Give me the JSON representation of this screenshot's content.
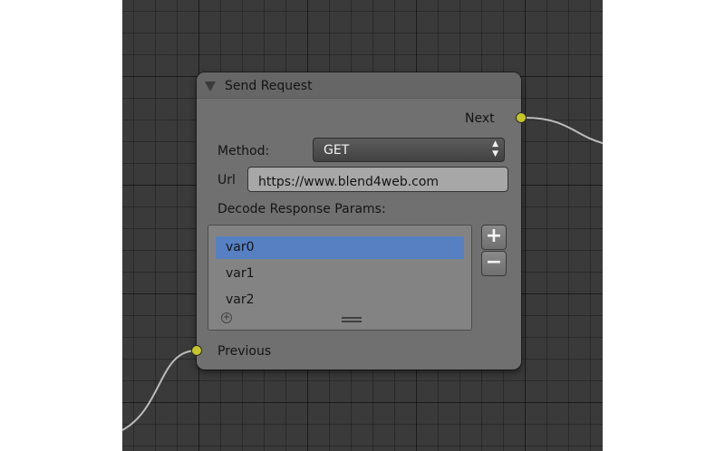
{
  "node": {
    "title": "Send Request",
    "outputs": {
      "next_label": "Next"
    },
    "inputs": {
      "previous_label": "Previous"
    },
    "method": {
      "label": "Method:",
      "value": "GET"
    },
    "url": {
      "label": "Url",
      "value": "https://www.blend4web.com"
    },
    "decode": {
      "label": "Decode Response Params:",
      "items": [
        {
          "label": "var0",
          "selected": true
        },
        {
          "label": "var1",
          "selected": false
        },
        {
          "label": "var2",
          "selected": false
        }
      ],
      "add_symbol": "+",
      "remove_symbol": "−"
    }
  },
  "colors": {
    "editor_background": "#3a3a3a",
    "node_body": "#707070",
    "socket": "#c6c629",
    "selection": "#5680c2",
    "link": "#bdbdbd"
  },
  "icons": [
    "collapse-arrow-icon",
    "select-arrows-icon",
    "add-icon",
    "remove-icon",
    "grip-icon"
  ]
}
